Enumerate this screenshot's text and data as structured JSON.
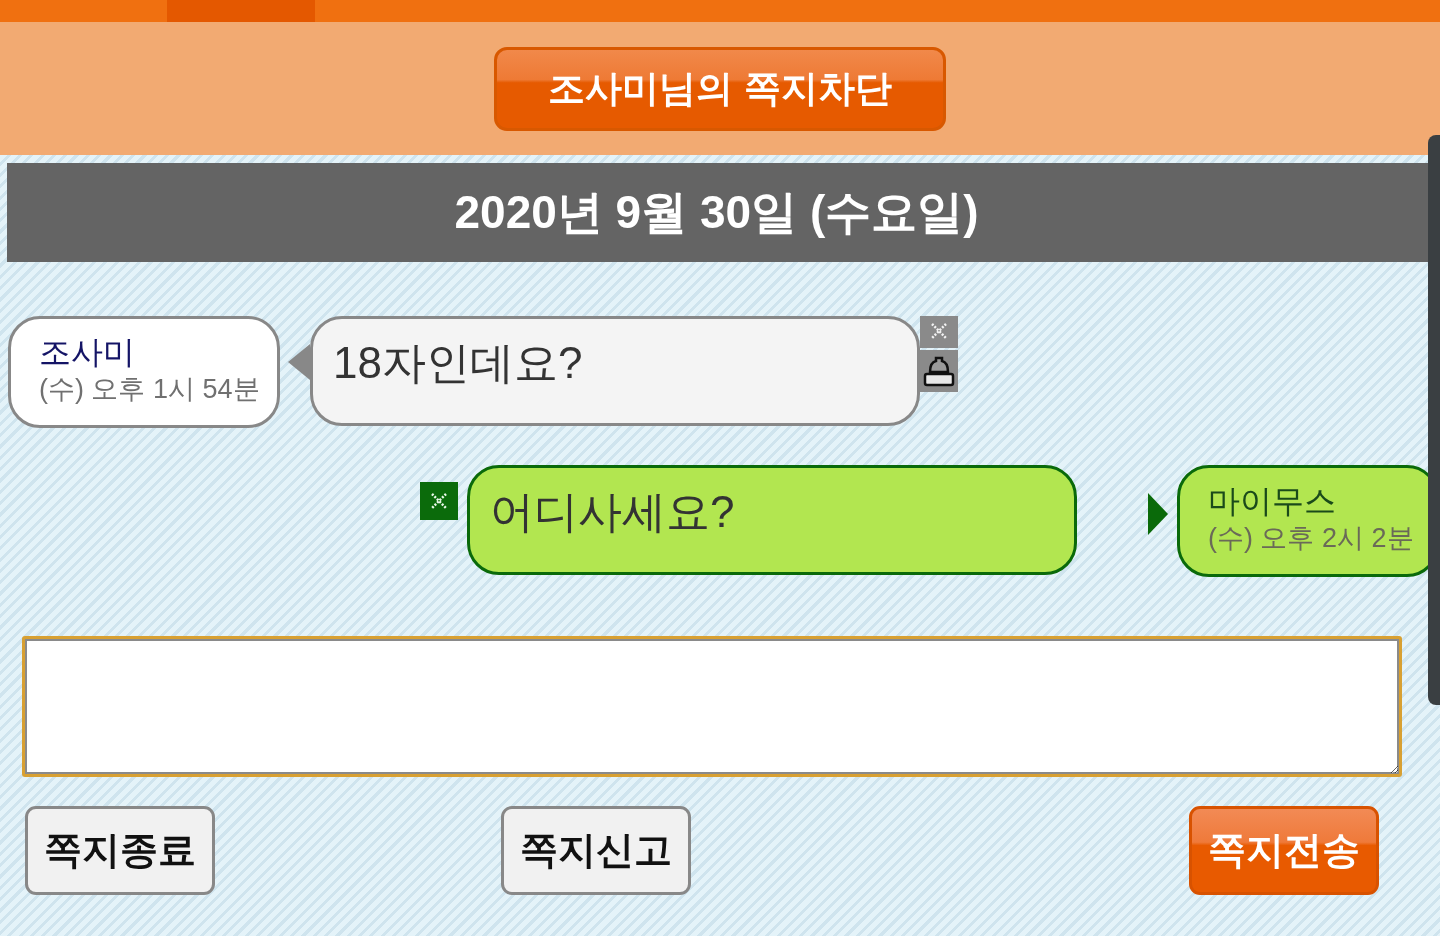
{
  "nav": {
    "tabs": [
      {
        "selected": true
      }
    ]
  },
  "header": {
    "block_button": "조사미님의 쪽지차단"
  },
  "date_bar": "2020년 9월 30일 (수요일)",
  "messages": [
    {
      "kind": "received",
      "sender": "조사미",
      "time": "(수) 오후 1시 54분",
      "text": "18자인데요?"
    },
    {
      "kind": "sent",
      "sender": "마이무스",
      "time": "(수) 오후 2시 2분",
      "text": "어디사세요?"
    }
  ],
  "buttons": [
    {
      "label": "쪽지종료",
      "kind": "secondary"
    },
    {
      "label": "쪽지신고",
      "kind": "secondary"
    },
    {
      "label": "쪽지전송",
      "kind": "primary"
    }
  ]
}
